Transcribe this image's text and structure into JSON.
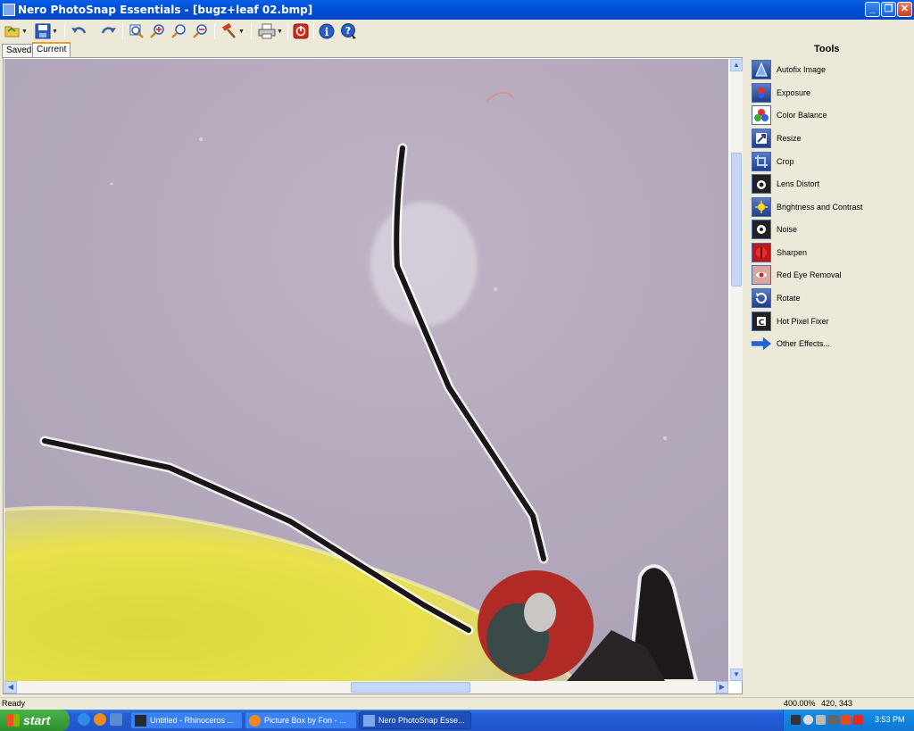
{
  "window": {
    "title": "Nero PhotoSnap Essentials - [bugz+leaf 02.bmp]",
    "minimize": "_",
    "restore": "❐",
    "close": "✕"
  },
  "tabs": [
    {
      "label": "Saved"
    },
    {
      "label": "Current"
    }
  ],
  "tools": {
    "heading": "Tools",
    "items": [
      {
        "label": "Autofix Image",
        "icon": "autofix-icon"
      },
      {
        "label": "Exposure",
        "icon": "exposure-icon"
      },
      {
        "label": "Color Balance",
        "icon": "color-balance-icon"
      },
      {
        "label": "Resize",
        "icon": "resize-icon"
      },
      {
        "label": "Crop",
        "icon": "crop-icon"
      },
      {
        "label": "Lens Distort",
        "icon": "lens-distort-icon"
      },
      {
        "label": "Brightness and Contrast",
        "icon": "brightness-icon"
      },
      {
        "label": "Noise",
        "icon": "noise-icon"
      },
      {
        "label": "Sharpen",
        "icon": "sharpen-icon"
      },
      {
        "label": "Red Eye Removal",
        "icon": "red-eye-icon"
      },
      {
        "label": "Rotate",
        "icon": "rotate-icon"
      },
      {
        "label": "Hot Pixel Fixer",
        "icon": "hot-pixel-icon"
      },
      {
        "label": "Other Effects...",
        "icon": "arrow-right-icon"
      }
    ]
  },
  "status": {
    "text": "Ready",
    "zoom": "400.00%",
    "coords": "420, 343"
  },
  "taskbar": {
    "start": "start",
    "tasks": [
      {
        "label": "Untitled - Rhinoceros ..."
      },
      {
        "label": "Picture Box by Fon - ..."
      },
      {
        "label": "Nero PhotoSnap Esse..."
      }
    ],
    "clock": "3:53 PM"
  },
  "colors": {
    "titlebar": "#0050d8",
    "window_bg": "#ece9d8",
    "photo_bg": "#b3a8b8"
  }
}
